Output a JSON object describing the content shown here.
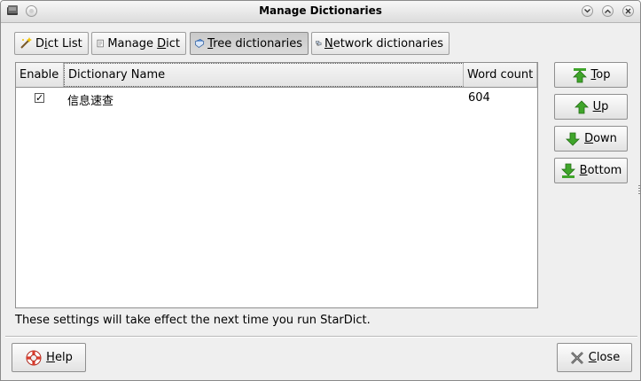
{
  "window": {
    "title": "Manage Dictionaries"
  },
  "tabs": [
    {
      "pre": "D",
      "key": "i",
      "post": "ct List"
    },
    {
      "pre": "Manage ",
      "key": "D",
      "post": "ict"
    },
    {
      "pre": "",
      "key": "T",
      "post": "ree dictionaries"
    },
    {
      "pre": "",
      "key": "N",
      "post": "etwork dictionaries"
    }
  ],
  "active_tab": "Tree dictionaries",
  "table": {
    "columns": [
      "Enable",
      "Dictionary Name",
      "Word count"
    ],
    "rows": [
      {
        "enabled": true,
        "check_glyph": "✓",
        "name": "信息速查",
        "count": "604"
      }
    ]
  },
  "side_buttons": [
    {
      "key": "T",
      "post": "op",
      "icon": "arrow-top-icon"
    },
    {
      "key": "U",
      "post": "p",
      "icon": "arrow-up-icon"
    },
    {
      "key": "D",
      "post": "own",
      "icon": "arrow-down-icon"
    },
    {
      "key": "B",
      "post": "ottom",
      "icon": "arrow-bottom-icon"
    }
  ],
  "note": "These settings will take effect the next time you run StarDict.",
  "help_button": {
    "key": "H",
    "post": "elp"
  },
  "close_button": {
    "key": "C",
    "post": "lose"
  },
  "colors": {
    "arrow_green": "#3fa52a",
    "help_red": "#d93a2b"
  }
}
